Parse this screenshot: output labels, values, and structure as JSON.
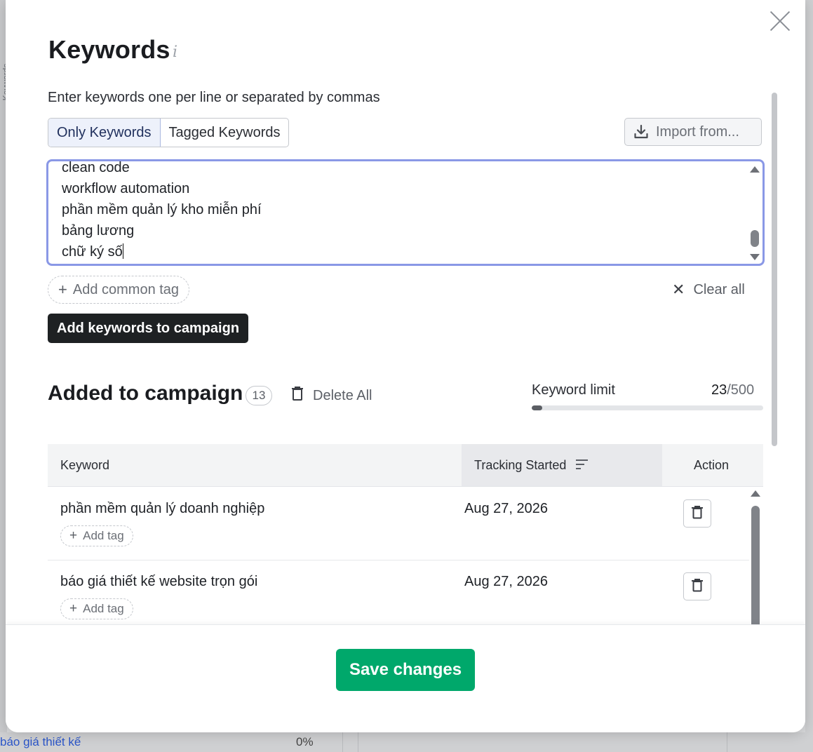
{
  "background": {
    "side_label": "Keywords",
    "bottom_link": "báo giá thiết kế",
    "bottom_pct": "0%"
  },
  "modal": {
    "title": "Keywords",
    "hint": "Enter keywords one per line or separated by commas",
    "tabs": [
      {
        "label": "Only Keywords",
        "active": true
      },
      {
        "label": "Tagged Keywords",
        "active": false
      }
    ],
    "import_label": "Import from...",
    "textarea_lines": [
      "clean code",
      "workflow automation",
      "phần mềm quản lý kho miễn phí",
      "bảng lương",
      "chữ ký số"
    ],
    "add_common_tag": "Add common tag",
    "clear_all": "Clear all",
    "add_button": "Add keywords to campaign",
    "section_title": "Added to campaign",
    "count": "13",
    "delete_all": "Delete All",
    "limit": {
      "label": "Keyword limit",
      "used": "23",
      "max": "/500",
      "fraction": 0.046
    },
    "table": {
      "columns": [
        "Keyword",
        "Tracking Started",
        "Action"
      ],
      "rows": [
        {
          "keyword": "phần mềm quản lý doanh nghiệp",
          "date": "Aug 27, 2026",
          "add_tag": "Add tag"
        },
        {
          "keyword": "báo giá thiết kế website trọn gói",
          "date": "Aug 27, 2026",
          "add_tag": "Add tag"
        }
      ]
    },
    "save_label": "Save changes"
  },
  "colors": {
    "primary_green": "#00a86b",
    "dark_button": "#1e2123",
    "focus_border": "#8a98e6"
  },
  "icons": [
    "info-icon",
    "close-icon",
    "download-icon",
    "plus-icon",
    "x-icon",
    "trash-icon",
    "sort-icon"
  ]
}
